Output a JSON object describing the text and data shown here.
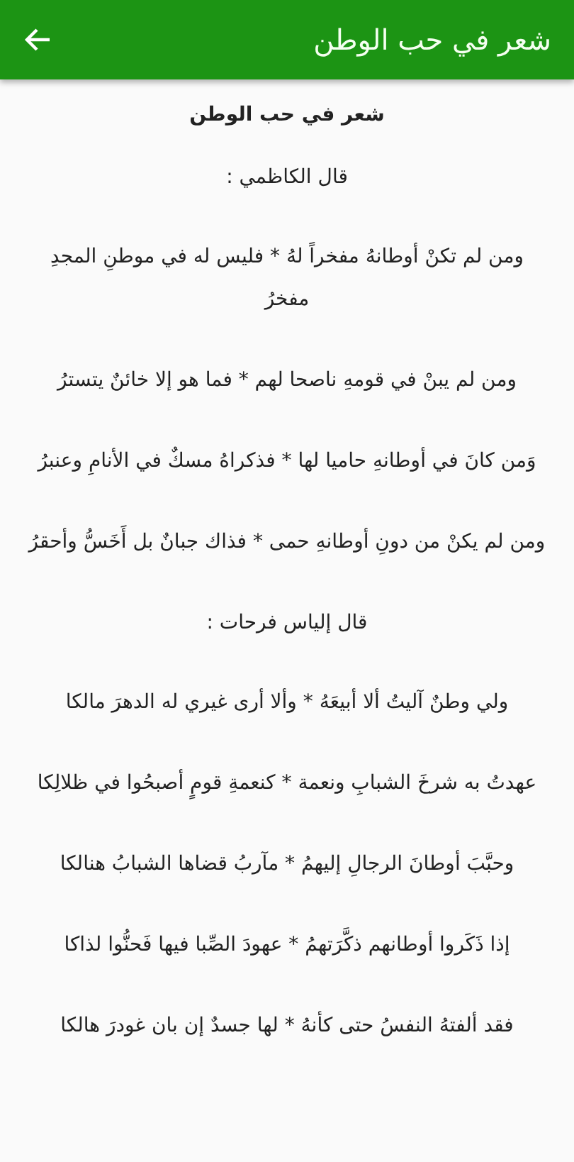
{
  "app_bar": {
    "title": "شعر في حب الوطن"
  },
  "content": [
    {
      "kind": "heading",
      "text": "شعر في حب الوطن"
    },
    {
      "kind": "poet",
      "text": "قال الكاظمي :"
    },
    {
      "kind": "verse",
      "text": "ومن لم تكنْ أوطانهُ مفخراً لهُ  *  فليس له في موطنِ المجدِ مفخرُ"
    },
    {
      "kind": "verse",
      "text": "ومن لم يبنْ في قومهِ ناصحا لهم  *  فما هو إلا خائنٌ يتسترُ"
    },
    {
      "kind": "verse",
      "text": "وَمن كانَ في أوطانهِ حاميا لها  *  فذكراهُ مسكٌ في الأنامِ وعنبرُ"
    },
    {
      "kind": "verse",
      "text": "ومن لم يكنْ من دونِ أوطانهِ حمى  *  فذاك جبانٌ بل أَخَسُّ وأحقرُ"
    },
    {
      "kind": "poet",
      "text": "قال إلياس فرحات :"
    },
    {
      "kind": "verse",
      "text": "ولي وطنٌ آليتُ ألا أبيعَهُ  *  وألا أرى غيري له الدهرَ مالكا"
    },
    {
      "kind": "verse",
      "text": "عهدتُ به شرخَ الشبابِ ونعمة  *  كنعمةِ قومٍ أصبحُوا في ظلالِكا"
    },
    {
      "kind": "verse",
      "text": "وحبَّبَ أوطانَ الرجالِ إليهمُ  *  مآربُ قضاها الشبابُ هنالكا"
    },
    {
      "kind": "verse",
      "text": "إذا ذَكَروا أوطانهم ذكَّرَتهمُ  *  عهودَ الصِّبا فيها فَحنُّوا لذاكا"
    },
    {
      "kind": "verse",
      "text": "فقد ألفتهُ النفسُ حتى كأنهُ  *  لها جسدٌ إن بان غودرَ هالكا"
    }
  ]
}
